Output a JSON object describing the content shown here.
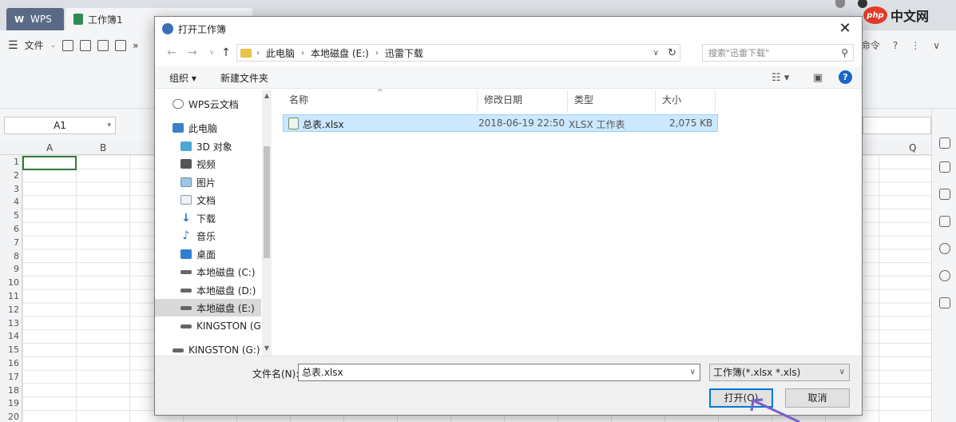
{
  "wps": {
    "home_tab": "WPS",
    "doc_tab": "工作簿1",
    "menu_file": "文件",
    "menu_more": "»",
    "find_cmd": "找命令",
    "help_q": "?",
    "more_dots": "⋮",
    "collapse": "∨",
    "cell_ref": "A1",
    "columns": [
      "A",
      "B"
    ],
    "col_q": "Q",
    "rows": [
      "1",
      "2",
      "3",
      "4",
      "5",
      "6",
      "7",
      "8",
      "9",
      "10",
      "11",
      "12",
      "13",
      "14",
      "15",
      "16",
      "17",
      "18",
      "19",
      "20"
    ]
  },
  "watermark": {
    "badge": "php",
    "text": "中文网"
  },
  "dialog": {
    "title": "打开工作簿",
    "close": "✕",
    "breadcrumb": [
      "此电脑",
      "本地磁盘 (E:)",
      "迅雷下载"
    ],
    "search_placeholder": "搜索\"迅雷下载\"",
    "organize": "组织 ▾",
    "new_folder": "新建文件夹",
    "help": "?",
    "nav_items": [
      {
        "label": "WPS云文档",
        "icon": "cloud-icon"
      },
      {
        "label": "此电脑",
        "icon": "computer-icon"
      },
      {
        "label": "3D 对象",
        "icon": "3d-objects-icon"
      },
      {
        "label": "视频",
        "icon": "video-icon"
      },
      {
        "label": "图片",
        "icon": "pictures-icon"
      },
      {
        "label": "文档",
        "icon": "documents-icon"
      },
      {
        "label": "下载",
        "icon": "download-icon"
      },
      {
        "label": "音乐",
        "icon": "music-icon"
      },
      {
        "label": "桌面",
        "icon": "desktop-icon"
      },
      {
        "label": "本地磁盘 (C:)",
        "icon": "drive-icon"
      },
      {
        "label": "本地磁盘 (D:)",
        "icon": "drive-icon"
      },
      {
        "label": "本地磁盘 (E:)",
        "icon": "drive-icon"
      },
      {
        "label": "KINGSTON (G:)",
        "icon": "usb-drive-icon"
      },
      {
        "label": "KINGSTON (G:)",
        "icon": "usb-drive-icon"
      }
    ],
    "columns": [
      "名称",
      "修改日期",
      "类型",
      "大小"
    ],
    "files": [
      {
        "name": "总表.xlsx",
        "modified": "2018-06-19 22:50",
        "type": "XLSX 工作表",
        "size": "2,075 KB"
      }
    ],
    "filename_label": "文件名(N):",
    "filename_value": "总表.xlsx",
    "filter_value": "工作簿(*.xlsx *.xls)",
    "open_button": "打开(O)",
    "cancel_button": "取消"
  },
  "colors": {
    "accent": "#0078d7",
    "selection": "#cce8ff",
    "wps_dark": "#5a6a86",
    "active_cell": "#2e7d32"
  }
}
